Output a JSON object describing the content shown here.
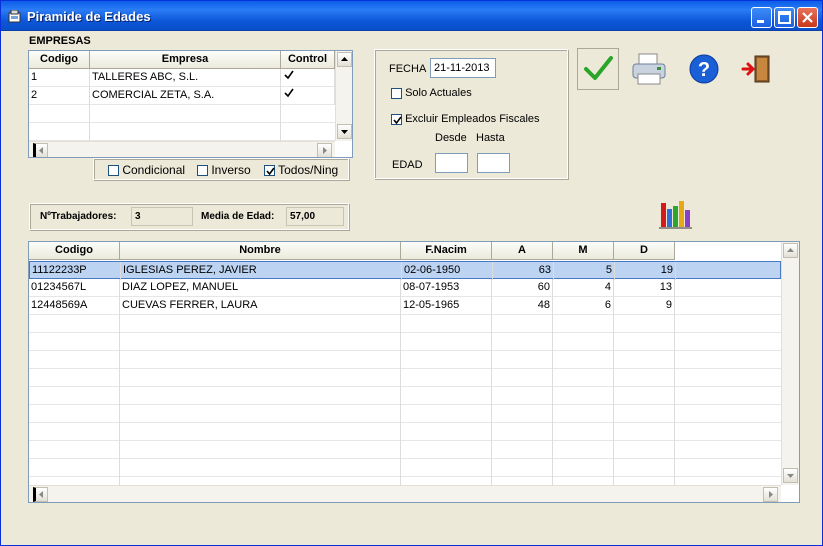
{
  "window": {
    "title": "Piramide de Edades"
  },
  "empresas": {
    "section_label": "EMPRESAS",
    "columns": [
      "Codigo",
      "Empresa",
      "Control"
    ],
    "rows": [
      {
        "codigo": "1",
        "empresa": "TALLERES ABC, S.L.",
        "control": true
      },
      {
        "codigo": "2",
        "empresa": "COMERCIAL ZETA, S.A.",
        "control": true
      }
    ]
  },
  "filters": {
    "condicional_label": "Condicional",
    "condicional_checked": false,
    "inverso_label": "Inverso",
    "inverso_checked": false,
    "todos_label": "Todos/Ning",
    "todos_checked": true
  },
  "params": {
    "fecha_label": "FECHA",
    "fecha_value": "21-11-2013",
    "solo_actuales_label": "Solo Actuales",
    "solo_actuales_checked": false,
    "excluir_label": "Excluir Empleados Fiscales",
    "excluir_checked": true,
    "desde_label": "Desde",
    "hasta_label": "Hasta",
    "edad_label": "EDAD",
    "desde_value": "",
    "hasta_value": ""
  },
  "summary": {
    "trabajadores_label": "NºTrabajadores:",
    "trabajadores_value": "3",
    "media_label": "Media de Edad:",
    "media_value": "57,00"
  },
  "toolbar": {
    "accept_icon": "checkmark-icon",
    "print_icon": "printer-icon",
    "help_icon": "help-icon",
    "exit_icon": "exit-door-icon",
    "chart_icon": "bar-chart-icon"
  },
  "employees": {
    "columns": [
      "Codigo",
      "Nombre",
      "F.Nacim",
      "A",
      "M",
      "D"
    ],
    "rows": [
      {
        "codigo": "11122233P",
        "nombre": "IGLESIAS PEREZ, JAVIER",
        "fnacim": "02-06-1950",
        "a": "63",
        "m": "5",
        "d": "19"
      },
      {
        "codigo": "01234567L",
        "nombre": "DIAZ  LOPEZ, MANUEL",
        "fnacim": "08-07-1953",
        "a": "60",
        "m": "4",
        "d": "13"
      },
      {
        "codigo": "12448569A",
        "nombre": "CUEVAS FERRER,  LAURA",
        "fnacim": "12-05-1965",
        "a": "48",
        "m": "6",
        "d": "9"
      }
    ]
  },
  "colors": {
    "titlebar": "#0a5ee8",
    "selection": "#bcd3f2",
    "accent_green": "#2aa52a"
  }
}
